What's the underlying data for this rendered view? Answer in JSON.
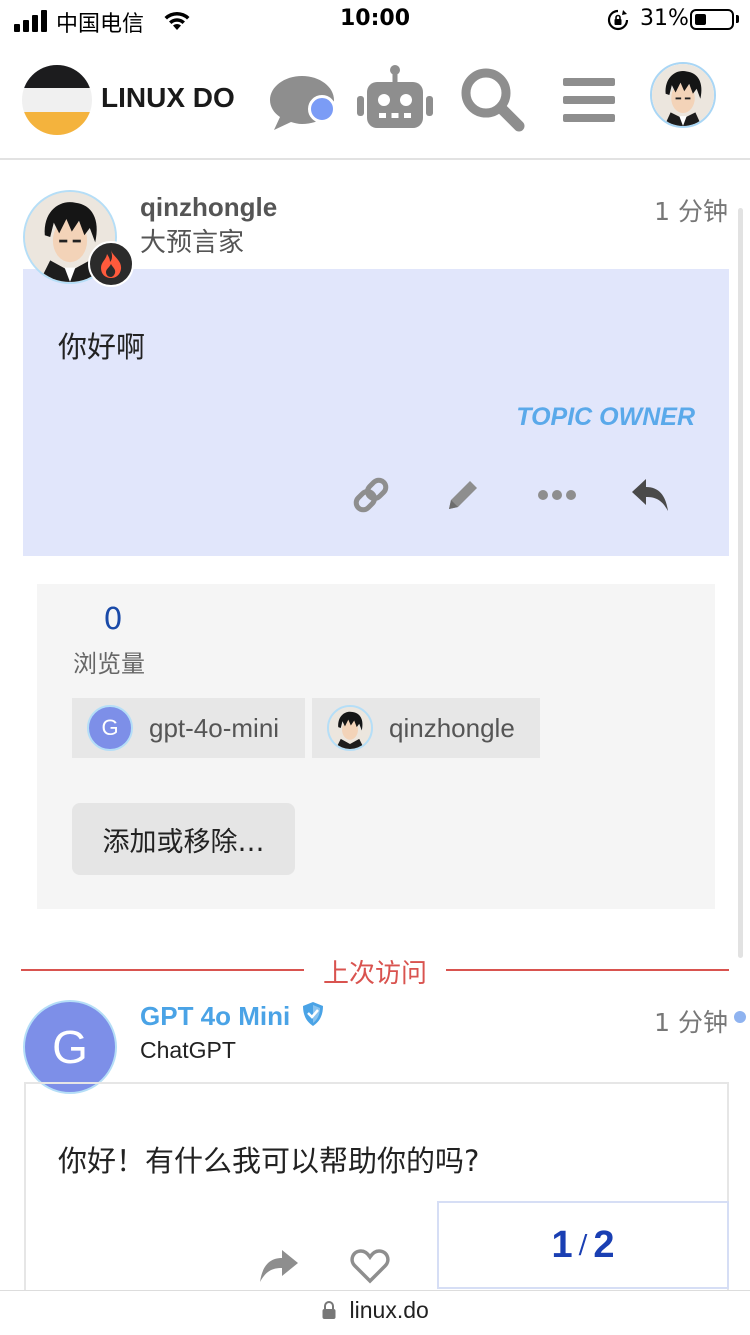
{
  "status_bar": {
    "carrier": "中国电信",
    "time": "10:00",
    "battery_pct": "31%",
    "battery_level": 0.31
  },
  "header": {
    "site_title": "LINUX DO",
    "icons": [
      "chat-icon",
      "robot-icon",
      "search-icon",
      "hamburger-menu-icon"
    ],
    "notification_color": "#7b9cf6"
  },
  "post1": {
    "username": "qinzhongle",
    "user_title": "大预言家",
    "time": "1 分钟",
    "body": "你好啊",
    "owner_badge": "TOPIC OWNER",
    "actions": [
      "link-icon",
      "edit-icon",
      "more-icon",
      "reply-icon"
    ],
    "bg_color": "#e1e6fb"
  },
  "topic_map": {
    "views_count": "0",
    "views_label": "浏览量",
    "participants": [
      {
        "avatar_letter": "G",
        "name": "gpt-4o-mini"
      },
      {
        "name": "qinzhongle"
      }
    ],
    "add_remove_label": "添加或移除…"
  },
  "last_visit": {
    "label": "上次访问",
    "color": "#d9534f"
  },
  "post2": {
    "avatar_letter": "G",
    "name": "GPT 4o Mini",
    "subtitle": "ChatGPT",
    "time": "1 分钟",
    "body": "你好！有什么我可以帮助你的吗?"
  },
  "progress": {
    "current": "1",
    "separator": "/",
    "total": "2"
  },
  "url_bar": {
    "url": "linux.do"
  }
}
